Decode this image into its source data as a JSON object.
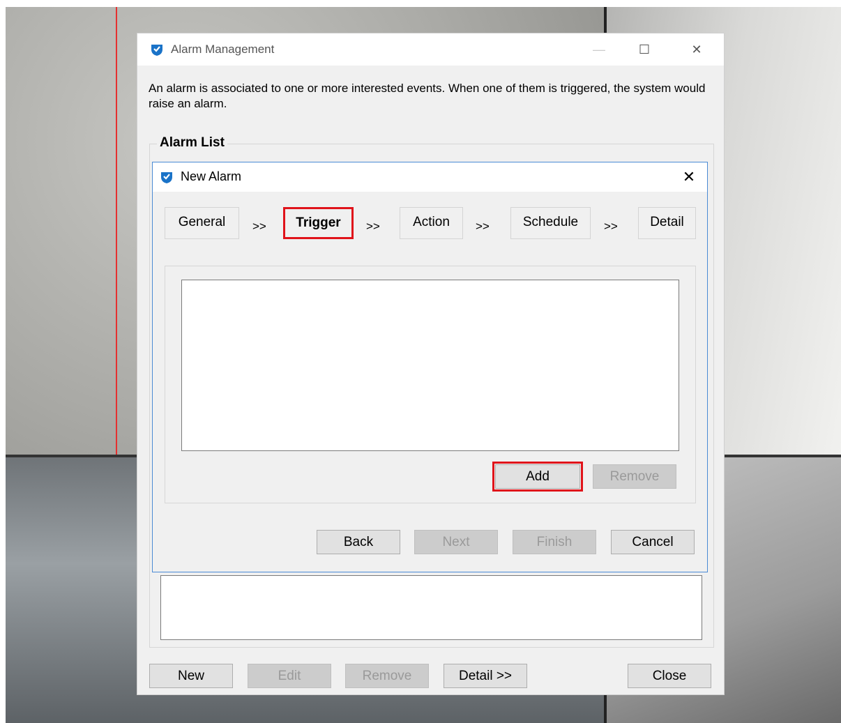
{
  "alarm_management": {
    "title": "Alarm Management",
    "window_controls": {
      "minimize": "—",
      "maximize": "☐",
      "close": "✕"
    },
    "description": "An alarm is associated to one or more interested events. When one of them is triggered, the system would raise an alarm.",
    "alarm_list_label": "Alarm List",
    "buttons": {
      "new": "New",
      "edit": "Edit",
      "remove": "Remove",
      "detail": "Detail >>",
      "close": "Close"
    },
    "disabled_buttons": [
      "Edit",
      "Remove"
    ]
  },
  "new_alarm": {
    "title": "New Alarm",
    "close_glyph": "✕",
    "steps": [
      {
        "label": "General",
        "active": false
      },
      {
        "label": "Trigger",
        "active": true
      },
      {
        "label": "Action",
        "active": false
      },
      {
        "label": "Schedule",
        "active": false
      },
      {
        "label": "Detail",
        "active": false
      }
    ],
    "step_separator": ">>",
    "trigger_buttons": {
      "add": "Add",
      "remove": "Remove"
    },
    "nav_buttons": {
      "back": "Back",
      "next": "Next",
      "finish": "Finish",
      "cancel": "Cancel"
    },
    "disabled_buttons": [
      "Remove",
      "Next",
      "Finish"
    ],
    "highlighted": [
      "Trigger",
      "Add"
    ]
  },
  "colors": {
    "highlight": "#e0131a",
    "accent_border": "#4a8ad4",
    "icon_blue": "#1a73c8"
  },
  "icons": {
    "app_icon": "checkmark-shield-icon"
  }
}
